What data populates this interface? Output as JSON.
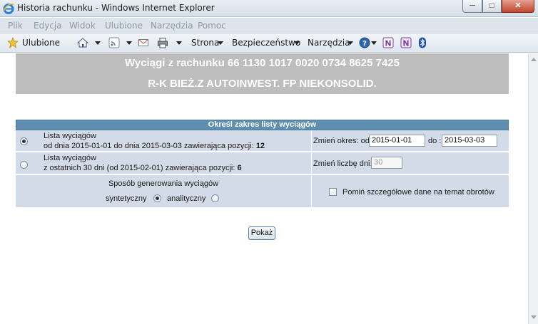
{
  "window": {
    "title": "Historia rachunku - Windows Internet Explorer"
  },
  "menu": {
    "items": [
      "Plik",
      "Edycja",
      "Widok",
      "Ulubione",
      "Narzędzia",
      "Pomoc"
    ]
  },
  "commandbar": {
    "favorites": "Ulubione",
    "page": "Strona",
    "security": "Bezpieczeństwo",
    "tools": "Narzędzia"
  },
  "header": {
    "line1": "Wyciągi z rachunku 66 1130 1017 0020 0734 8625 7425",
    "line2": "R-K BIEŻ.Z AUTOINWEST. FP NIEKONSOLID."
  },
  "form": {
    "table_title": "Określ zakres listy wyciągów",
    "option1": {
      "label": "Lista wyciągów",
      "detail": "od dnia 2015-01-01 do dnia 2015-03-03 zawierająca pozycji: ",
      "count": "12",
      "selected": true
    },
    "option2": {
      "label": "Lista wyciągów",
      "detail": "z ostatnich 30 dni (od 2015-02-01) zawierająca pozycji: ",
      "count": "6",
      "selected": false
    },
    "period": {
      "label_from": "Zmień okres: od",
      "from": "2015-01-01",
      "label_to": "do :",
      "to": "2015-03-03"
    },
    "count_change": {
      "label": "Zmień liczbę dni:",
      "value": "30"
    },
    "generation": {
      "label": "Sposób generowania wyciągów",
      "synthetic": "syntetyczny",
      "analytic": "analityczny",
      "selected": "syntetyczny"
    },
    "skip_details": {
      "label": "Pomiń szczegółowe dane na temat obrotów",
      "checked": false
    },
    "submit": "Pokaż"
  }
}
